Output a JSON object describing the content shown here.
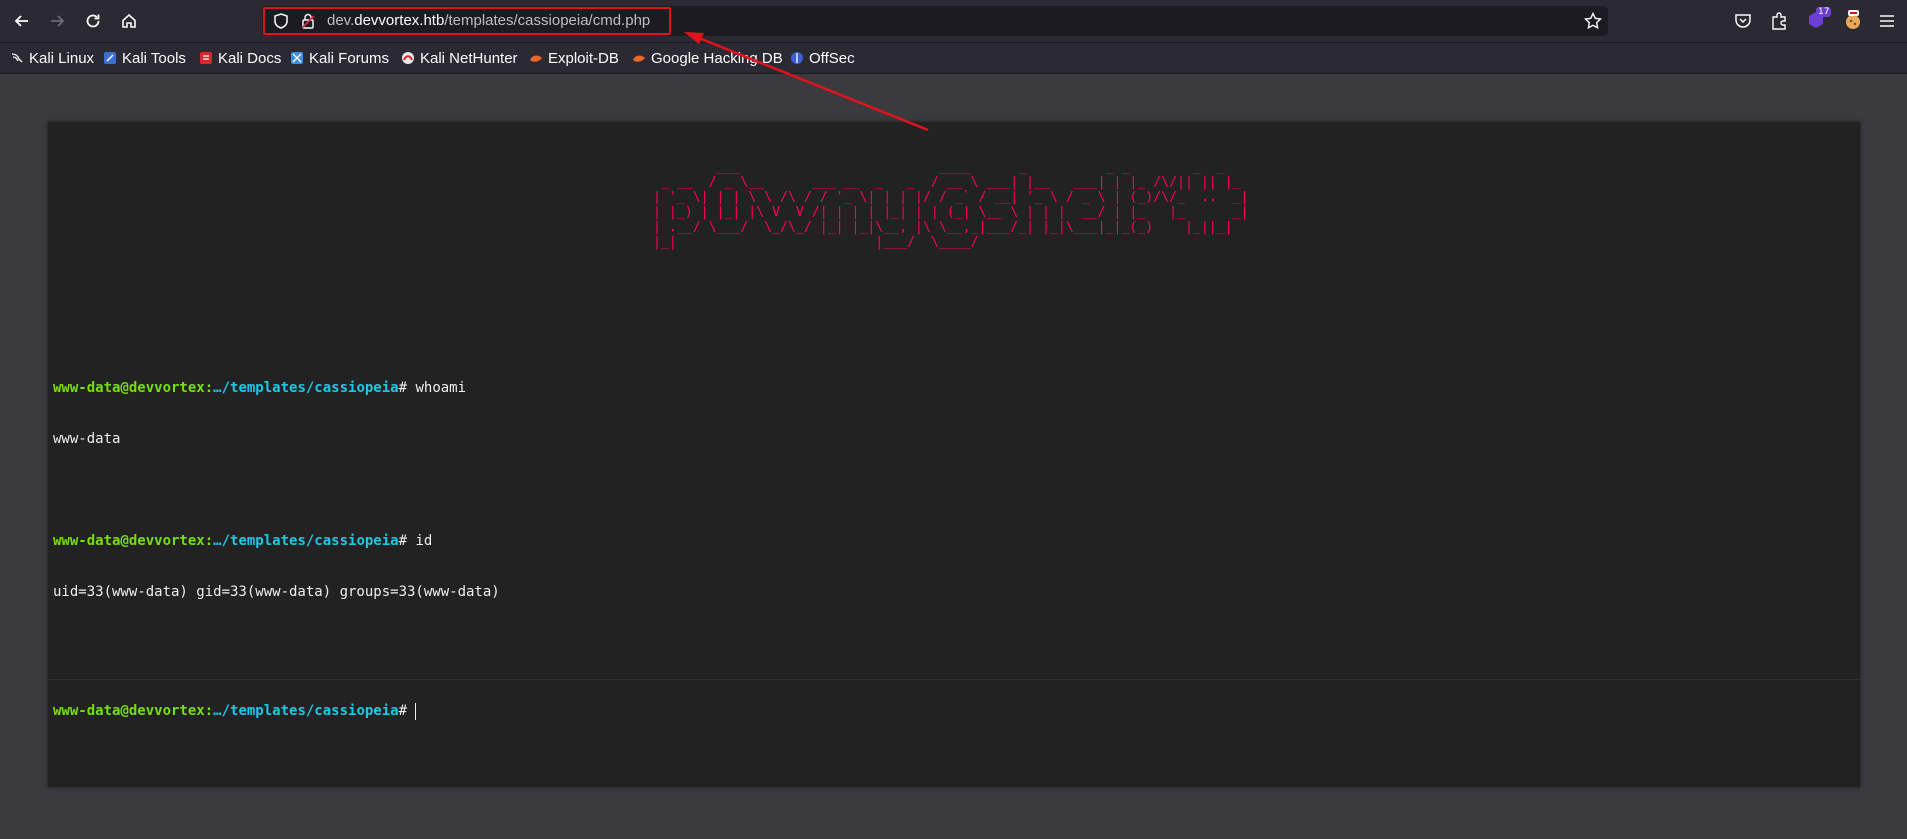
{
  "browser": {
    "url": {
      "prefix": "dev.",
      "domain": "devvortex.htb",
      "path": "/templates/cassiopeia/cmd.php"
    },
    "badge_count": "17",
    "bookmarks": [
      {
        "label": "Kali Linux",
        "icon": "kali-dragon-icon"
      },
      {
        "label": "Kali Tools",
        "icon": "kali-tools-icon"
      },
      {
        "label": "Kali Docs",
        "icon": "kali-docs-icon"
      },
      {
        "label": "Kali Forums",
        "icon": "kali-forums-icon"
      },
      {
        "label": "Kali NetHunter",
        "icon": "nethunter-icon"
      },
      {
        "label": "Exploit-DB",
        "icon": "exploit-db-icon"
      },
      {
        "label": "Google Hacking DB",
        "icon": "ghdb-icon"
      },
      {
        "label": "OffSec",
        "icon": "offsec-icon"
      }
    ]
  },
  "shell": {
    "banner": "        ___                         ____      _          _ _        _  _   \n _ __  / _ \\__      ___ __  _   _  / __ \\ ___| |__   ___| | |_ /\\/|| || |_ \n| '_ \\| | | \\ \\ /\\ / / '_ \\| | | |/ / _` / __| '_ \\ / _ \\ | (_)/\\/_  ..  _|\n| |_) | |_| |\\ V  V /| | | | |_| | | (_| \\__ \\ | | |  __/ | |_   |_      _|\n| .__/ \\___/  \\_/\\_/ |_| |_|\\__, |\\ \\__,_|___/_| |_|\\___|_|_(_)    |_||_|  \n|_|                         |___/  \\____/                                  ",
    "prompt_user": "www-data@devvortex",
    "prompt_sep": ":",
    "prompt_path": "…/templates/cassiopeia",
    "prompt_hash": "#",
    "history": [
      {
        "command": "whoami",
        "output": "www-data"
      },
      {
        "command": "id",
        "output": "uid=33(www-data) gid=33(www-data) groups=33(www-data)"
      }
    ],
    "input_value": ""
  },
  "colors": {
    "annotation_red": "#e0141b",
    "prompt_user": "#75df0b",
    "prompt_path": "#1bc9e7",
    "banner": "#ff0054"
  }
}
